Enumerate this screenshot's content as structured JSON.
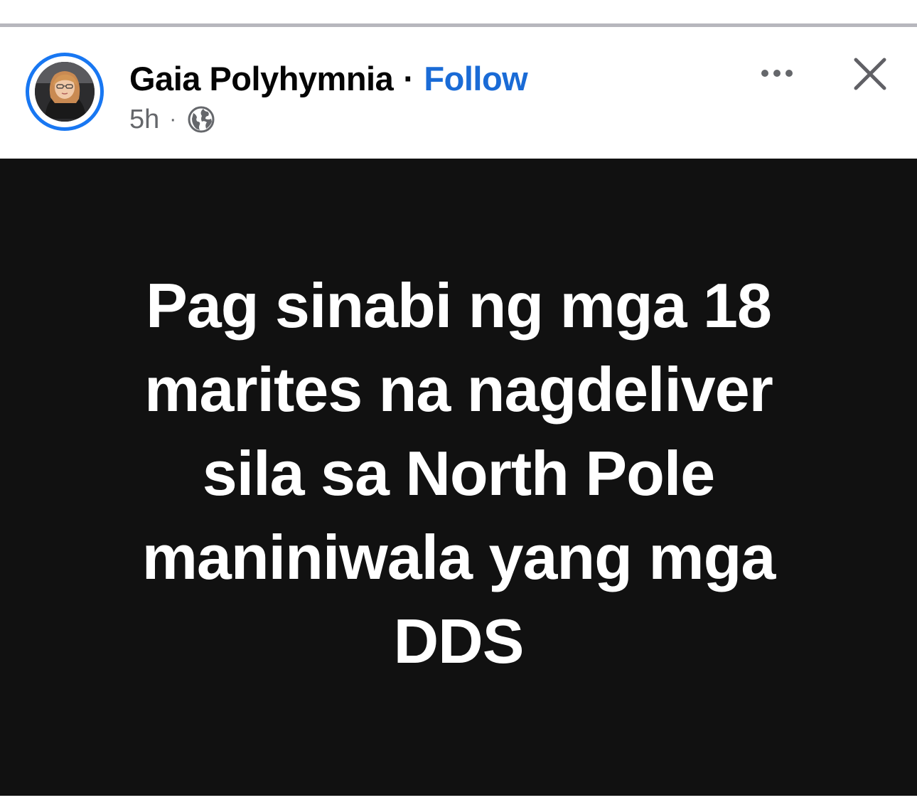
{
  "post": {
    "author_name": "Gaia Polyhymnia",
    "separator": "·",
    "follow_label": "Follow",
    "time_ago": "5h",
    "meta_separator": "·",
    "audience_icon": "globe-icon",
    "more_icon": "more-horizontal-icon",
    "close_icon": "close-icon",
    "text_lines": [
      "Pag sinabi ng mga 18",
      "marites na nagdeliver",
      "sila sa North Pole",
      "maniniwala yang mga",
      "DDS"
    ]
  },
  "colors": {
    "accent": "#1877f2",
    "follow_text": "#1a6bd6",
    "post_background": "#111111",
    "post_text": "#ffffff",
    "meta_text": "#65676b"
  }
}
